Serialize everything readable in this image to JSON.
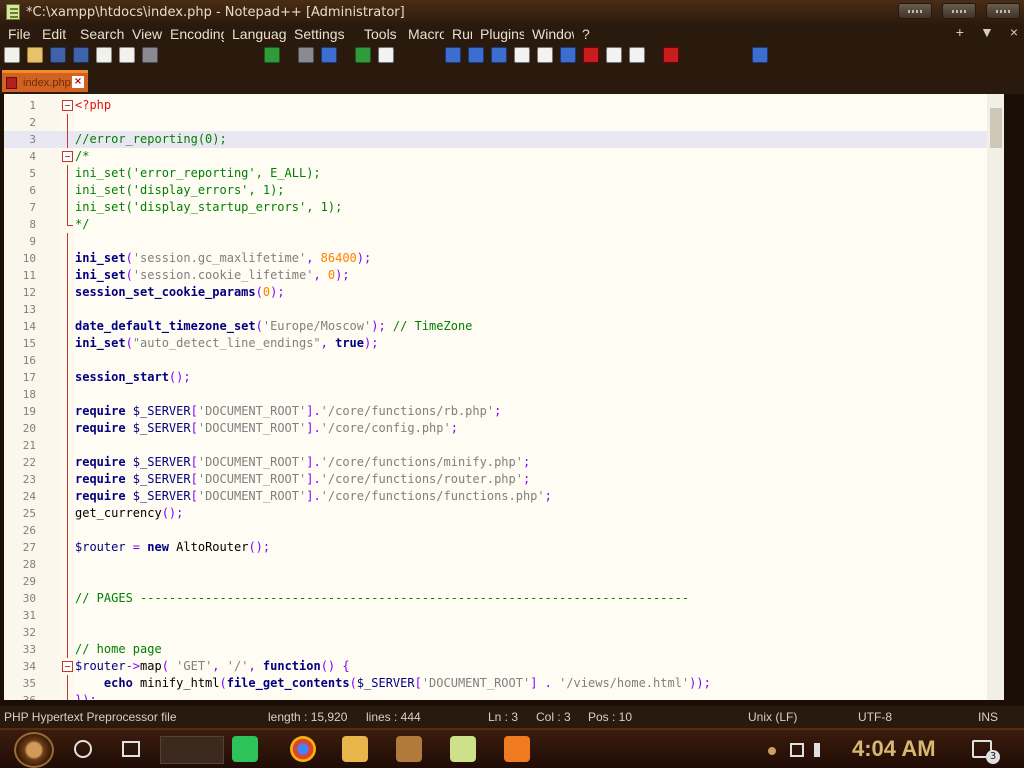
{
  "window": {
    "title": "*C:\\xampp\\htdocs\\index.php - Notepad++ [Administrator]"
  },
  "menu": {
    "items": [
      "File",
      "Edit",
      "Search",
      "View",
      "Encoding",
      "Language",
      "Settings",
      "Tools",
      "Macro",
      "Run",
      "Plugins",
      "Window",
      "?"
    ],
    "right": [
      "+",
      "▼",
      "×"
    ]
  },
  "tab": {
    "label": "index.php",
    "close": "×"
  },
  "editor": {
    "lines": [
      {
        "n": "1",
        "tokens": [
          {
            "t": "<?php",
            "c": "#e11010"
          }
        ]
      },
      {
        "n": "2",
        "tokens": []
      },
      {
        "n": "3",
        "tokens": [
          {
            "t": "//error_reporting(0);",
            "c": "#008000"
          }
        ]
      },
      {
        "n": "4",
        "tokens": [
          {
            "t": "/*",
            "c": "#008000"
          }
        ]
      },
      {
        "n": "5",
        "tokens": [
          {
            "t": "ini_set('error_reporting', E_ALL);",
            "c": "#008000"
          }
        ]
      },
      {
        "n": "6",
        "tokens": [
          {
            "t": "ini_set('display_errors', 1);",
            "c": "#008000"
          }
        ]
      },
      {
        "n": "7",
        "tokens": [
          {
            "t": "ini_set('display_startup_errors', 1);",
            "c": "#008000"
          }
        ]
      },
      {
        "n": "8",
        "tokens": [
          {
            "t": "*/",
            "c": "#008000"
          }
        ]
      },
      {
        "n": "9",
        "tokens": []
      },
      {
        "n": "10",
        "tokens": [
          {
            "t": "ini_set",
            "c": "#000080",
            "b": true
          },
          {
            "t": "(",
            "c": "#8000ff"
          },
          {
            "t": "'session.gc_maxlifetime'",
            "c": "#808080"
          },
          {
            "t": ", ",
            "c": "#8000ff"
          },
          {
            "t": "86400",
            "c": "#ff8000"
          },
          {
            "t": ");",
            "c": "#8000ff"
          }
        ]
      },
      {
        "n": "11",
        "tokens": [
          {
            "t": "ini_set",
            "c": "#000080",
            "b": true
          },
          {
            "t": "(",
            "c": "#8000ff"
          },
          {
            "t": "'session.cookie_lifetime'",
            "c": "#808080"
          },
          {
            "t": ", ",
            "c": "#8000ff"
          },
          {
            "t": "0",
            "c": "#ff8000"
          },
          {
            "t": ");",
            "c": "#8000ff"
          }
        ]
      },
      {
        "n": "12",
        "tokens": [
          {
            "t": "session_set_cookie_params",
            "c": "#000080",
            "b": true
          },
          {
            "t": "(",
            "c": "#8000ff"
          },
          {
            "t": "0",
            "c": "#ff8000"
          },
          {
            "t": ");",
            "c": "#8000ff"
          }
        ]
      },
      {
        "n": "13",
        "tokens": []
      },
      {
        "n": "14",
        "tokens": [
          {
            "t": "date_default_timezone_set",
            "c": "#000080",
            "b": true
          },
          {
            "t": "(",
            "c": "#8000ff"
          },
          {
            "t": "'Europe/Moscow'",
            "c": "#808080"
          },
          {
            "t": "); ",
            "c": "#8000ff"
          },
          {
            "t": "// TimeZone",
            "c": "#008000"
          }
        ]
      },
      {
        "n": "15",
        "tokens": [
          {
            "t": "ini_set",
            "c": "#000080",
            "b": true
          },
          {
            "t": "(",
            "c": "#8000ff"
          },
          {
            "t": "\"auto_detect_line_endings\"",
            "c": "#808080"
          },
          {
            "t": ", ",
            "c": "#8000ff"
          },
          {
            "t": "true",
            "c": "#000080",
            "b": true
          },
          {
            "t": ");",
            "c": "#8000ff"
          }
        ]
      },
      {
        "n": "16",
        "tokens": []
      },
      {
        "n": "17",
        "tokens": [
          {
            "t": "session_start",
            "c": "#000080",
            "b": true
          },
          {
            "t": "();",
            "c": "#8000ff"
          }
        ]
      },
      {
        "n": "18",
        "tokens": []
      },
      {
        "n": "19",
        "tokens": [
          {
            "t": "require",
            "c": "#000080",
            "b": true
          },
          {
            "t": " $_SERVER",
            "c": "#000080"
          },
          {
            "t": "[",
            "c": "#8000ff"
          },
          {
            "t": "'DOCUMENT_ROOT'",
            "c": "#808080"
          },
          {
            "t": "].",
            "c": "#8000ff"
          },
          {
            "t": "'/core/functions/rb.php'",
            "c": "#808080"
          },
          {
            "t": ";",
            "c": "#8000ff"
          }
        ]
      },
      {
        "n": "20",
        "tokens": [
          {
            "t": "require",
            "c": "#000080",
            "b": true
          },
          {
            "t": " $_SERVER",
            "c": "#000080"
          },
          {
            "t": "[",
            "c": "#8000ff"
          },
          {
            "t": "'DOCUMENT_ROOT'",
            "c": "#808080"
          },
          {
            "t": "].",
            "c": "#8000ff"
          },
          {
            "t": "'/core/config.php'",
            "c": "#808080"
          },
          {
            "t": ";",
            "c": "#8000ff"
          }
        ]
      },
      {
        "n": "21",
        "tokens": []
      },
      {
        "n": "22",
        "tokens": [
          {
            "t": "require",
            "c": "#000080",
            "b": true
          },
          {
            "t": " $_SERVER",
            "c": "#000080"
          },
          {
            "t": "[",
            "c": "#8000ff"
          },
          {
            "t": "'DOCUMENT_ROOT'",
            "c": "#808080"
          },
          {
            "t": "].",
            "c": "#8000ff"
          },
          {
            "t": "'/core/functions/minify.php'",
            "c": "#808080"
          },
          {
            "t": ";",
            "c": "#8000ff"
          }
        ]
      },
      {
        "n": "23",
        "tokens": [
          {
            "t": "require",
            "c": "#000080",
            "b": true
          },
          {
            "t": " $_SERVER",
            "c": "#000080"
          },
          {
            "t": "[",
            "c": "#8000ff"
          },
          {
            "t": "'DOCUMENT_ROOT'",
            "c": "#808080"
          },
          {
            "t": "].",
            "c": "#8000ff"
          },
          {
            "t": "'/core/functions/router.php'",
            "c": "#808080"
          },
          {
            "t": ";",
            "c": "#8000ff"
          }
        ]
      },
      {
        "n": "24",
        "tokens": [
          {
            "t": "require",
            "c": "#000080",
            "b": true
          },
          {
            "t": " $_SERVER",
            "c": "#000080"
          },
          {
            "t": "[",
            "c": "#8000ff"
          },
          {
            "t": "'DOCUMENT_ROOT'",
            "c": "#808080"
          },
          {
            "t": "].",
            "c": "#8000ff"
          },
          {
            "t": "'/core/functions/functions.php'",
            "c": "#808080"
          },
          {
            "t": ";",
            "c": "#8000ff"
          }
        ]
      },
      {
        "n": "25",
        "tokens": [
          {
            "t": "get_currency",
            "c": "#000000"
          },
          {
            "t": "();",
            "c": "#8000ff"
          }
        ]
      },
      {
        "n": "26",
        "tokens": []
      },
      {
        "n": "27",
        "tokens": [
          {
            "t": "$router",
            "c": "#000080"
          },
          {
            "t": " = ",
            "c": "#8000ff"
          },
          {
            "t": "new",
            "c": "#000080",
            "b": true
          },
          {
            "t": " AltoRouter",
            "c": "#000000"
          },
          {
            "t": "();",
            "c": "#8000ff"
          }
        ]
      },
      {
        "n": "28",
        "tokens": []
      },
      {
        "n": "29",
        "tokens": []
      },
      {
        "n": "30",
        "tokens": [
          {
            "t": "// PAGES ----------------------------------------------------------------------------",
            "c": "#008000"
          }
        ]
      },
      {
        "n": "31",
        "tokens": []
      },
      {
        "n": "32",
        "tokens": []
      },
      {
        "n": "33",
        "tokens": [
          {
            "t": "// home page",
            "c": "#008000"
          }
        ]
      },
      {
        "n": "34",
        "tokens": [
          {
            "t": "$router",
            "c": "#000080"
          },
          {
            "t": "->",
            "c": "#8000ff"
          },
          {
            "t": "map",
            "c": "#000000"
          },
          {
            "t": "( ",
            "c": "#8000ff"
          },
          {
            "t": "'GET'",
            "c": "#808080"
          },
          {
            "t": ", ",
            "c": "#8000ff"
          },
          {
            "t": "'/'",
            "c": "#808080"
          },
          {
            "t": ", ",
            "c": "#8000ff"
          },
          {
            "t": "function",
            "c": "#000080",
            "b": true
          },
          {
            "t": "() {",
            "c": "#8000ff"
          }
        ]
      },
      {
        "n": "35",
        "tokens": [
          {
            "t": "    echo",
            "c": "#000080",
            "b": true
          },
          {
            "t": " minify_html",
            "c": "#000000"
          },
          {
            "t": "(",
            "c": "#8000ff"
          },
          {
            "t": "file_get_contents",
            "c": "#000080",
            "b": true
          },
          {
            "t": "(",
            "c": "#8000ff"
          },
          {
            "t": "$_SERVER",
            "c": "#000080"
          },
          {
            "t": "[",
            "c": "#8000ff"
          },
          {
            "t": "'DOCUMENT_ROOT'",
            "c": "#808080"
          },
          {
            "t": "] . ",
            "c": "#8000ff"
          },
          {
            "t": "'/views/home.html'",
            "c": "#808080"
          },
          {
            "t": "));",
            "c": "#8000ff"
          }
        ]
      },
      {
        "n": "36",
        "tokens": [
          {
            "t": "});",
            "c": "#8000ff"
          }
        ]
      }
    ]
  },
  "status": {
    "file_type": "PHP Hypertext Preprocessor file",
    "length": "length : 15,920",
    "lines": "lines : 444",
    "ln": "Ln : 3",
    "col": "Col : 3",
    "pos": "Pos : 10",
    "eol": "Unix (LF)",
    "encoding": "UTF-8",
    "mode": "INS"
  },
  "taskbar": {
    "time": "4:04 AM",
    "notification_count": "3"
  }
}
